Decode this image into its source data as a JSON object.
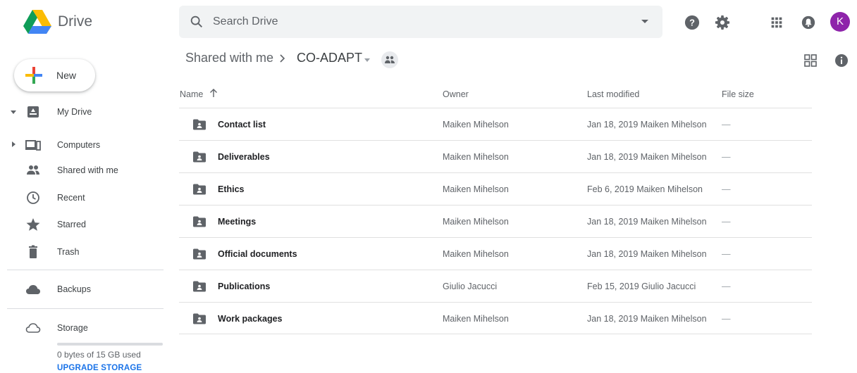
{
  "app": {
    "brand": "Drive"
  },
  "search": {
    "placeholder": "Search Drive"
  },
  "header": {
    "avatar_letter": "K"
  },
  "colors": {
    "accent": "#1a73e8",
    "avatar": "#8e24aa",
    "icon_grey": "#5f6368"
  },
  "new_button": {
    "label": "New"
  },
  "sidebar": {
    "items": [
      {
        "label": "My Drive",
        "icon": "my-drive-icon"
      },
      {
        "label": "Computers",
        "icon": "computers-icon"
      },
      {
        "label": "Shared with me",
        "icon": "shared-with-me-icon"
      },
      {
        "label": "Recent",
        "icon": "recent-icon"
      },
      {
        "label": "Starred",
        "icon": "star-icon"
      },
      {
        "label": "Trash",
        "icon": "trash-icon"
      },
      {
        "label": "Backups",
        "icon": "cloud-icon"
      },
      {
        "label": "Storage",
        "icon": "cloud-outline-icon"
      }
    ],
    "storage_used_text": "0 bytes of 15 GB used",
    "storage_fraction": 0,
    "upgrade_label": "UPGRADE STORAGE"
  },
  "breadcrumb": {
    "parent": "Shared with me",
    "current": "CO-ADAPT"
  },
  "table": {
    "headers": {
      "name": "Name",
      "owner": "Owner",
      "modified": "Last modified",
      "size": "File size"
    },
    "rows": [
      {
        "name": "Contact list",
        "owner": "Maiken Mihelson",
        "modified": "Jan 18, 2019 Maiken Mihelson",
        "size": "—"
      },
      {
        "name": "Deliverables",
        "owner": "Maiken Mihelson",
        "modified": "Jan 18, 2019 Maiken Mihelson",
        "size": "—"
      },
      {
        "name": "Ethics",
        "owner": "Maiken Mihelson",
        "modified": "Feb 6, 2019 Maiken Mihelson",
        "size": "—"
      },
      {
        "name": "Meetings",
        "owner": "Maiken Mihelson",
        "modified": "Jan 18, 2019 Maiken Mihelson",
        "size": "—"
      },
      {
        "name": "Official documents",
        "owner": "Maiken Mihelson",
        "modified": "Jan 18, 2019 Maiken Mihelson",
        "size": "—"
      },
      {
        "name": "Publications",
        "owner": "Giulio Jacucci",
        "modified": "Feb 15, 2019 Giulio Jacucci",
        "size": "—"
      },
      {
        "name": "Work packages",
        "owner": "Maiken Mihelson",
        "modified": "Jan 18, 2019 Maiken Mihelson",
        "size": "—"
      }
    ]
  }
}
